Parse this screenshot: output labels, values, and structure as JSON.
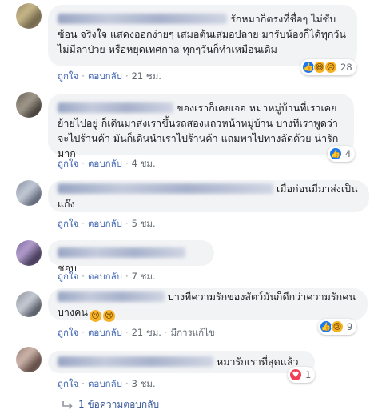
{
  "actions": {
    "like": "ถูกใจ",
    "reply": "ตอบกลับ",
    "separator": "·",
    "edited": "มีการแก้ไข"
  },
  "comments": [
    {
      "text": "รักหมาก็ตรงที่ชื่อๆ ไม่ซับซ้อน จริงใจ แสดงออกง่ายๆ เสมอต้นเสมอปลาย มารับน้องก็ได้ทุกวัน ไม่มีลาป่วย หรือหยุดเทศกาล ทุกๆวันก็ทำเหมือนเดิม",
      "time": "21 ชม.",
      "reactions": {
        "icons": [
          "like-icon",
          "haha-icon",
          "sad-icon"
        ],
        "count": "28"
      }
    },
    {
      "text": "ของเราก็เคยเจอ หมาหมู่บ้านที่เราเคยย้ายไปอยู่ ก็เดินมาส่งเราขึ้นรถสองแถวหน้าหมู่บ้าน บางทีเราพูดว่าจะไปร้านค้า มันก็เดินนำเราไปร้านค้า แถมพาไปทางลัดด้วย น่ารักมาก",
      "time": "4 ชม.",
      "reactions": {
        "icons": [
          "like-icon"
        ],
        "count": "4"
      }
    },
    {
      "text": "เมื่อก่อนมีมาส่งเป็นแก๊ง",
      "time": "5 ชม."
    },
    {
      "text": "ชอบ",
      "time": "7 ชม."
    },
    {
      "text": "บางทีความรักของสัตว์มันก็ดีกว่าความรักคนบางคน",
      "time": "21 ชม.",
      "reactions": {
        "icons": [
          "like-icon",
          "sad-icon"
        ],
        "count": "9"
      }
    },
    {
      "text": "หมารักเราที่สุดแล้ว",
      "time": "3 ชม.",
      "reactions": {
        "icons": [
          "love-icon"
        ],
        "count": "1"
      }
    }
  ],
  "replies_link": "1 ข้อความตอบกลับ",
  "colors": {
    "bubble": "#f2f3f5",
    "link": "#4267b2",
    "like": "#1877f2",
    "love": "#f33e58",
    "emoji": "#f7b125"
  }
}
